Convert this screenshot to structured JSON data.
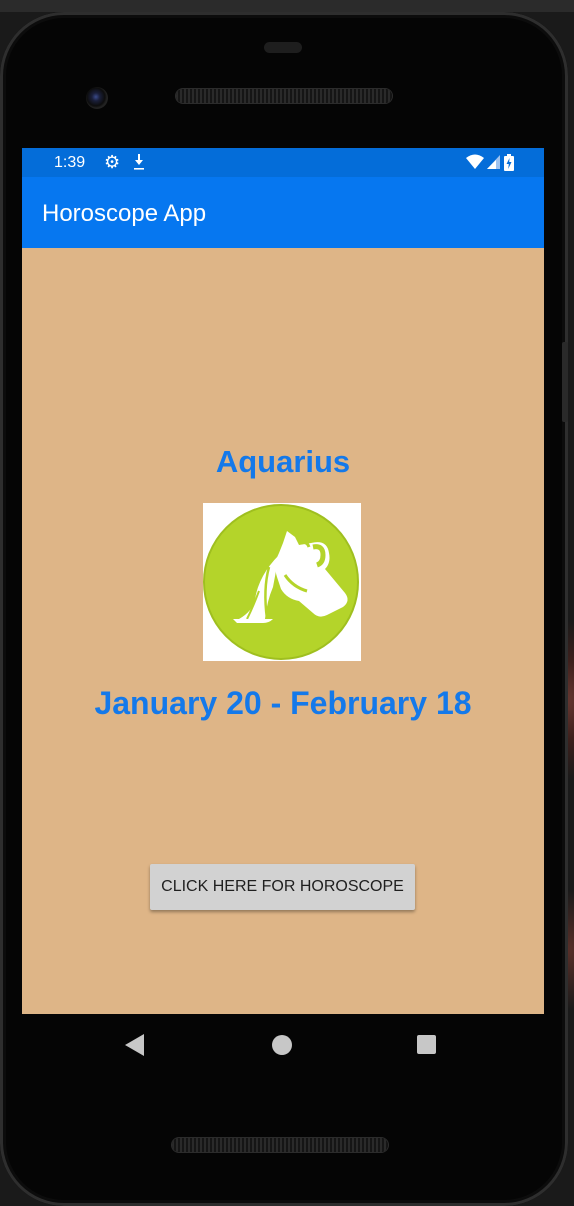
{
  "status_bar": {
    "time": "1:39",
    "left_icons": [
      "gear-icon",
      "download-icon"
    ],
    "right_icons": [
      "wifi-icon",
      "cellular-signal-icon",
      "battery-icon"
    ]
  },
  "app_bar": {
    "title": "Horoscope App",
    "color": "#0677f0"
  },
  "main": {
    "sign_name": "Aquarius",
    "sign_image_icon": "aquarius-icon",
    "date_range": "January 20 - February 18",
    "button_label": "CLICK HERE FOR HOROSCOPE",
    "background_color": "#deb587",
    "text_color": "#1479ea"
  },
  "nav_bar": {
    "buttons": [
      "back",
      "home",
      "recents"
    ]
  }
}
